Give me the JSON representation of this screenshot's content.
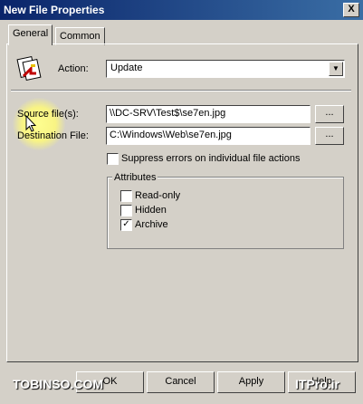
{
  "window": {
    "title": "New File Properties",
    "close_label": "X"
  },
  "tabs": [
    {
      "label": "General"
    },
    {
      "label": "Common"
    }
  ],
  "action": {
    "label": "Action:",
    "value": "Update"
  },
  "source": {
    "label": "Source file(s):",
    "value": "\\\\DC-SRV\\Test$\\se7en.jpg",
    "browse": "..."
  },
  "destination": {
    "label": "Destination File:",
    "value": "C:\\Windows\\Web\\se7en.jpg",
    "browse": "..."
  },
  "suppress": {
    "label": "Suppress errors on individual file actions",
    "checked": false
  },
  "attributes": {
    "title": "Attributes",
    "items": [
      {
        "label": "Read-only",
        "checked": false
      },
      {
        "label": "Hidden",
        "checked": false
      },
      {
        "label": "Archive",
        "checked": true
      }
    ]
  },
  "buttons": {
    "ok": "OK",
    "cancel": "Cancel",
    "apply": "Apply",
    "help": "Help"
  },
  "watermark": {
    "left": "TOBINSO.COM",
    "right": "ITPro.ir"
  }
}
